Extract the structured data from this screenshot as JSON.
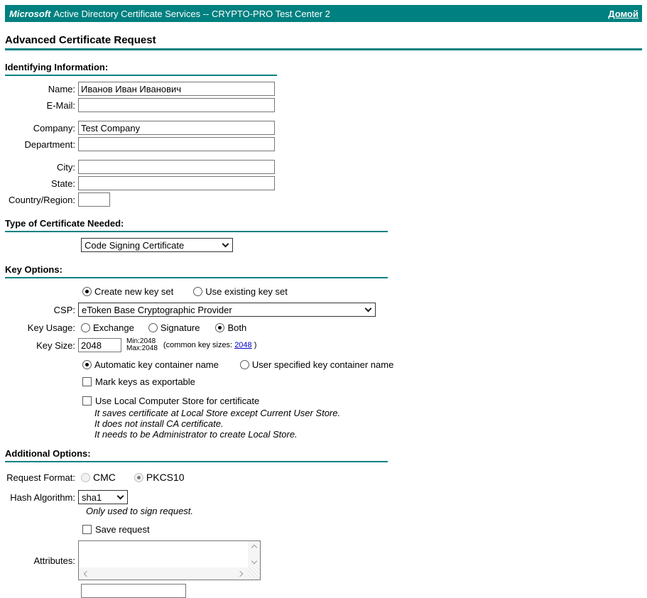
{
  "header": {
    "brand": "Microsoft",
    "title": "Active Directory Certificate Services  --  CRYPTO-PRO Test Center 2",
    "home": "Домой"
  },
  "page_title": "Advanced Certificate Request",
  "identifying": {
    "heading": "Identifying Information:",
    "fields": [
      {
        "label": "Name:",
        "value": "Иванов Иван Иванович"
      },
      {
        "label": "E-Mail:",
        "value": ""
      },
      {
        "label": "Company:",
        "value": "Test Company"
      },
      {
        "label": "Department:",
        "value": ""
      },
      {
        "label": "City:",
        "value": ""
      },
      {
        "label": "State:",
        "value": ""
      },
      {
        "label": "Country/Region:",
        "value": ""
      }
    ]
  },
  "cert_type": {
    "heading": "Type of Certificate Needed:",
    "selected": "Code Signing Certificate"
  },
  "key_options": {
    "heading": "Key Options:",
    "key_set": {
      "create_label": "Create new key set",
      "existing_label": "Use existing key set",
      "selected": "create"
    },
    "csp": {
      "label": "CSP:",
      "selected": "eToken Base Cryptographic Provider"
    },
    "key_usage": {
      "label": "Key Usage:",
      "options": [
        "Exchange",
        "Signature",
        "Both"
      ],
      "selected": "Both"
    },
    "key_size": {
      "label": "Key Size:",
      "value": "2048",
      "min": "Min:2048",
      "max": "Max:2048",
      "common_prefix": "(common key sizes:",
      "common_link": "2048",
      "common_suffix": ")"
    },
    "container": {
      "auto_label": "Automatic key container name",
      "user_label": "User specified key container name",
      "selected": "auto"
    },
    "exportable": {
      "label": "Mark keys as exportable",
      "checked": false
    },
    "local_store": {
      "label": "Use Local Computer Store for certificate",
      "checked": false,
      "notes": [
        "It saves certificate at Local Store except Current User Store.",
        "It does not install CA certificate.",
        "It needs to be Administrator to create Local Store."
      ]
    }
  },
  "additional": {
    "heading": "Additional Options:",
    "request_format": {
      "label": "Request Format:",
      "cmc_label": "CMC",
      "pkcs10_label": "PKCS10",
      "selected": "PKCS10"
    },
    "hash": {
      "label": "Hash Algorithm:",
      "selected": "sha1",
      "note": "Only used to sign request."
    },
    "save_request": {
      "label": "Save request",
      "checked": false
    },
    "attributes": {
      "label": "Attributes:",
      "value": ""
    }
  },
  "colors": {
    "teal": "#008080",
    "link_blue": "#0000CC"
  }
}
